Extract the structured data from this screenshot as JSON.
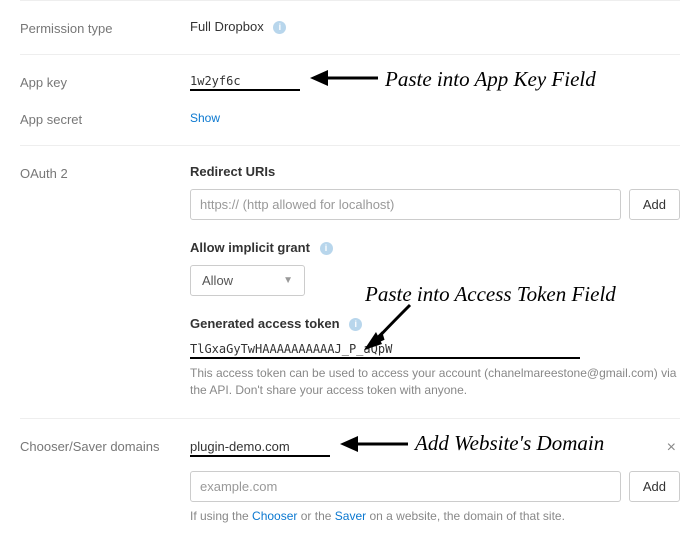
{
  "permission_type": {
    "label": "Permission type",
    "value": "Full Dropbox"
  },
  "app_key": {
    "label": "App key",
    "value": "1w2yf6c"
  },
  "app_secret": {
    "label": "App secret",
    "show_link": "Show"
  },
  "oauth2": {
    "label": "OAuth 2",
    "redirect_title": "Redirect URIs",
    "redirect_placeholder": "https:// (http allowed for localhost)",
    "add_label": "Add",
    "implicit_title": "Allow implicit grant",
    "implicit_value": "Allow",
    "token_title": "Generated access token",
    "token_value": "TlGxaGyTwHAAAAAAAAAAJ_P_aQpW",
    "token_help": "This access token can be used to access your account (chanelmareestone@gmail.com) via the API. Don't share your access token with anyone."
  },
  "chooser": {
    "label": "Chooser/Saver domains",
    "domain_value": "plugin-demo.com",
    "input_placeholder": "example.com",
    "add_label": "Add",
    "help_prefix": "If using the ",
    "help_chooser": "Chooser",
    "help_mid": " or the ",
    "help_saver": "Saver",
    "help_suffix": " on a website, the domain of that site."
  },
  "annotations": {
    "app_key": "Paste into App Key Field",
    "token": "Paste into Access Token Field",
    "domain": "Add Website's Domain"
  }
}
